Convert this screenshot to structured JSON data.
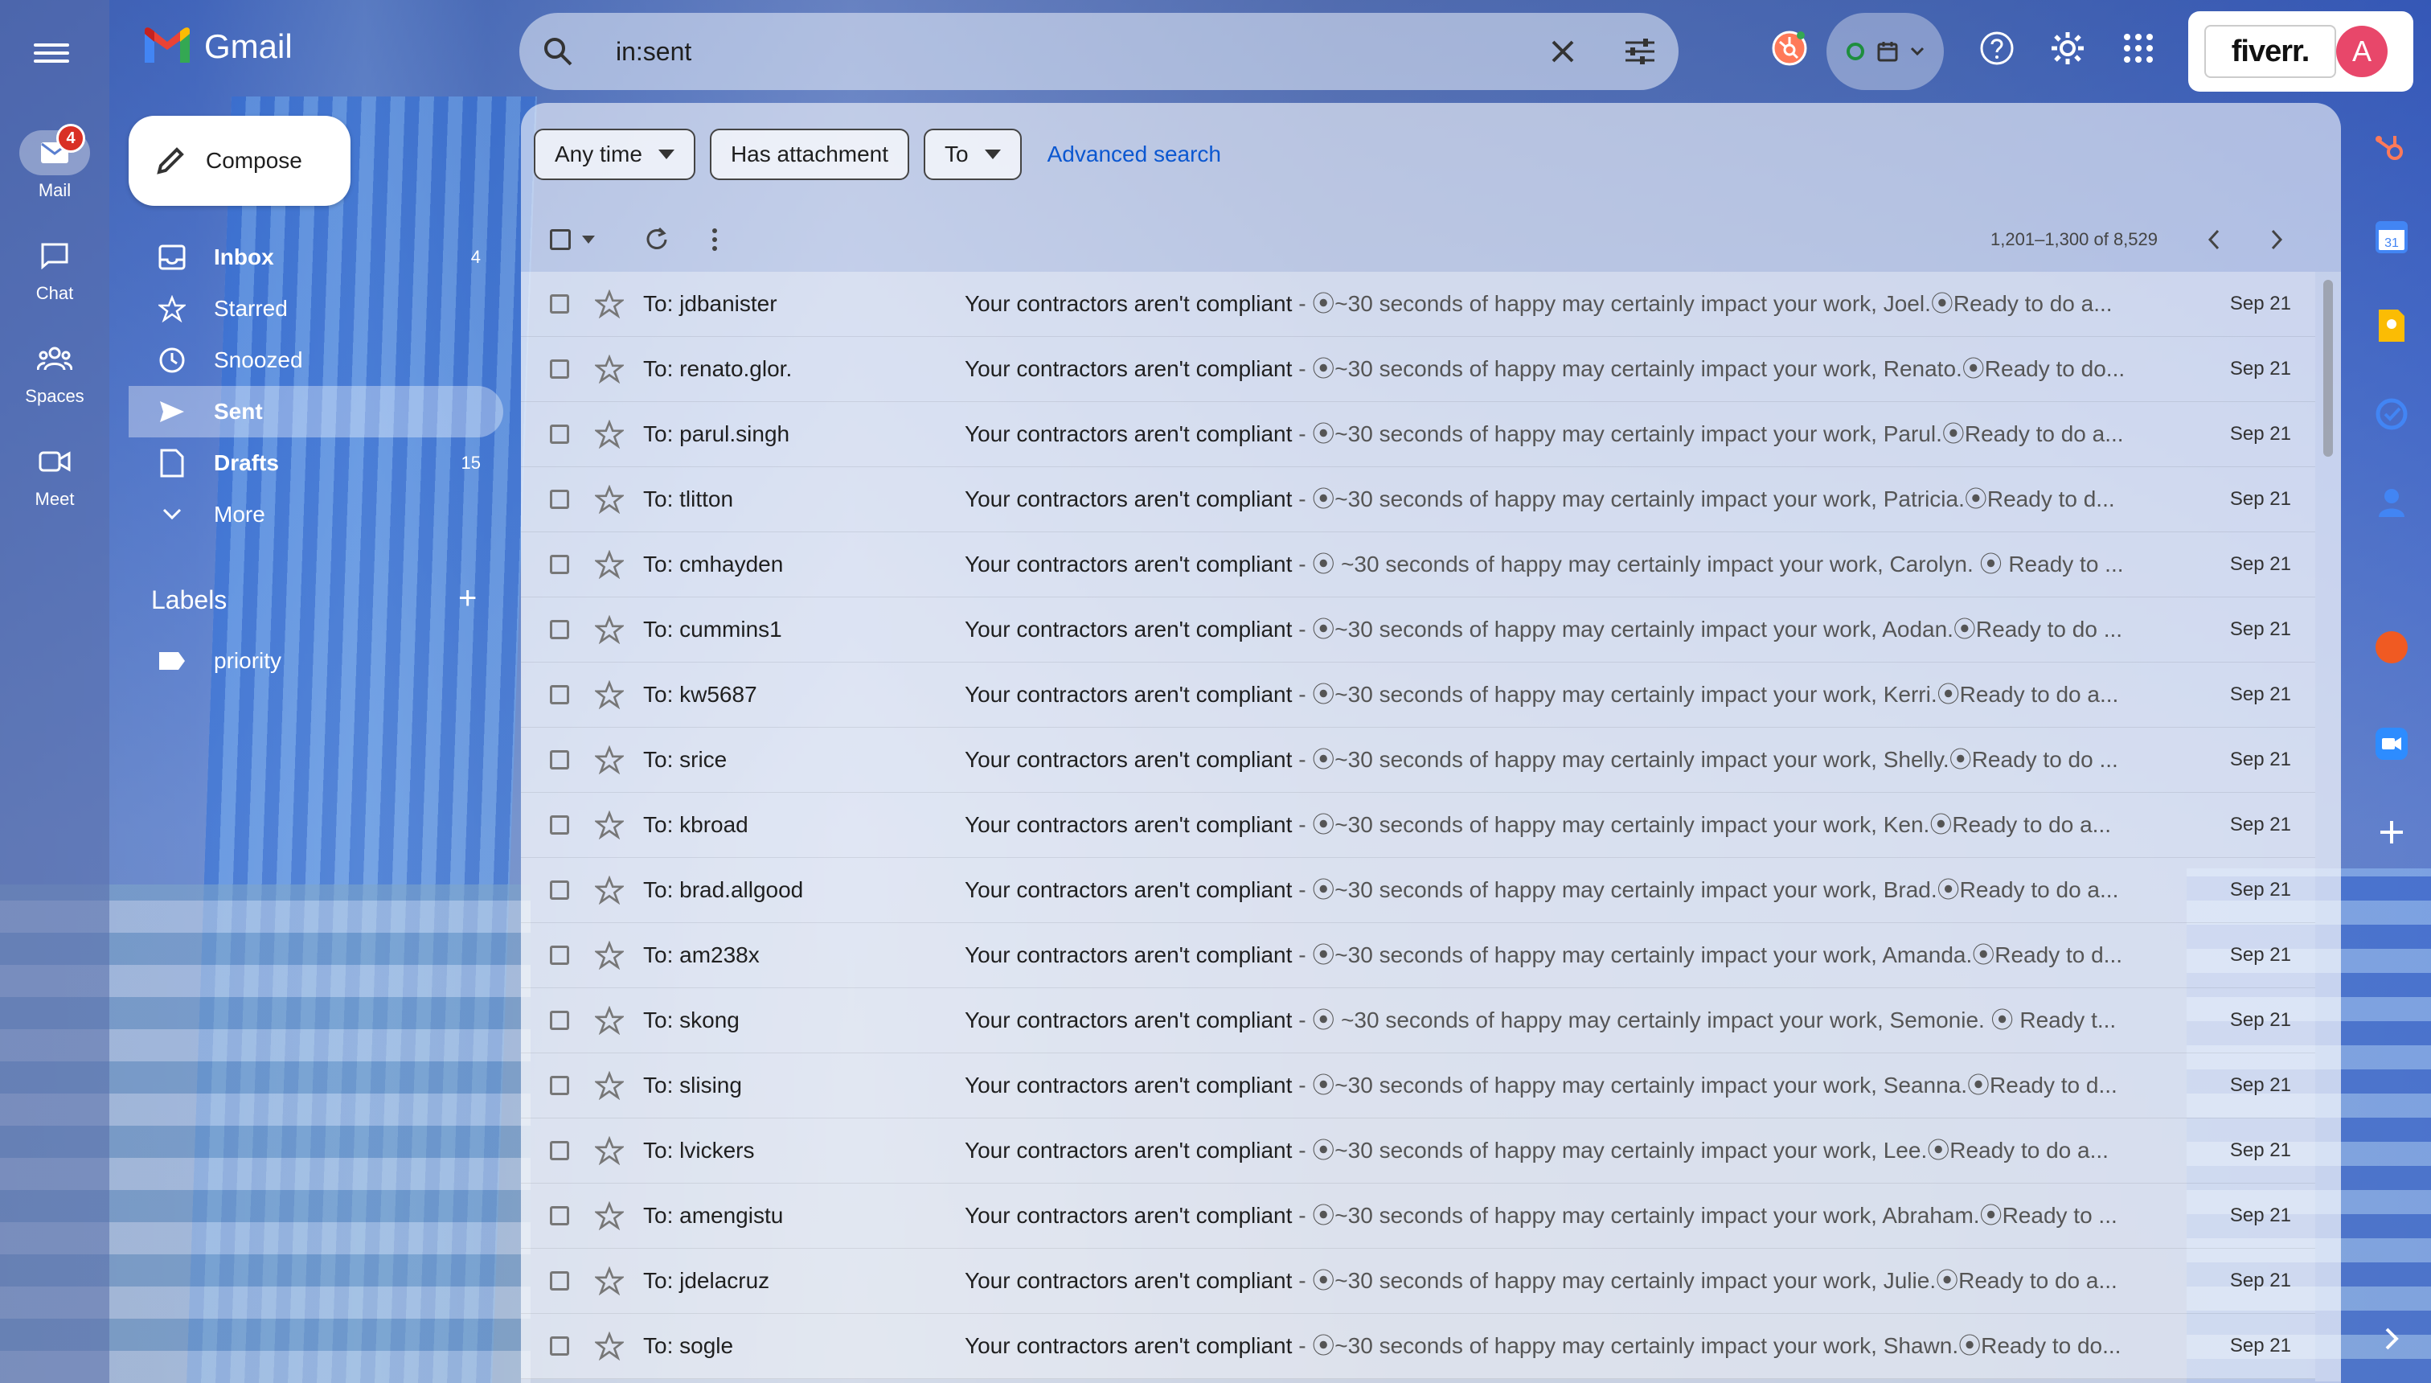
{
  "app": {
    "name": "Gmail"
  },
  "rail": [
    {
      "label": "Mail",
      "badge": "4",
      "icon": "mail-icon"
    },
    {
      "label": "Chat",
      "icon": "chat-icon"
    },
    {
      "label": "Spaces",
      "icon": "spaces-icon"
    },
    {
      "label": "Meet",
      "icon": "meet-icon"
    }
  ],
  "search": {
    "query": "in:sent"
  },
  "profile": {
    "initial": "A",
    "fiverr_label": "fiverr."
  },
  "compose": {
    "label": "Compose"
  },
  "nav": [
    {
      "label": "Inbox",
      "count": "4",
      "icon": "inbox-icon"
    },
    {
      "label": "Starred",
      "count": "",
      "icon": "star-icon"
    },
    {
      "label": "Snoozed",
      "count": "",
      "icon": "clock-icon"
    },
    {
      "label": "Sent",
      "count": "",
      "icon": "send-icon"
    },
    {
      "label": "Drafts",
      "count": "15",
      "icon": "draft-icon"
    },
    {
      "label": "More",
      "count": "",
      "icon": "chevron-down-icon"
    }
  ],
  "labels": {
    "heading": "Labels",
    "items": [
      {
        "label": "priority"
      }
    ]
  },
  "filters": {
    "any_time": "Any time",
    "has_attachment": "Has attachment",
    "to": "To",
    "advanced": "Advanced search"
  },
  "pager": {
    "text": "1,201–1,300 of 8,529"
  },
  "emails": [
    {
      "to": "To: jdbanister",
      "subject": "Your contractors aren't compliant",
      "snippet": " - ⦿~30 seconds of happy may certainly impact your work, Joel.⦿Ready to do a...",
      "date": "Sep 21"
    },
    {
      "to": "To: renato.glor.",
      "subject": "Your contractors aren't compliant",
      "snippet": " - ⦿~30 seconds of happy may certainly impact your work, Renato.⦿Ready to do...",
      "date": "Sep 21"
    },
    {
      "to": "To: parul.singh",
      "subject": "Your contractors aren't compliant",
      "snippet": " - ⦿~30 seconds of happy may certainly impact your work, Parul.⦿Ready to do a...",
      "date": "Sep 21"
    },
    {
      "to": "To: tlitton",
      "subject": "Your contractors aren't compliant",
      "snippet": " - ⦿~30 seconds of happy may certainly impact your work, Patricia.⦿Ready to d...",
      "date": "Sep 21"
    },
    {
      "to": "To: cmhayden",
      "subject": "Your contractors aren't compliant",
      "snippet": " - ⦿ ~30 seconds of happy may certainly impact your work, Carolyn. ⦿ Ready to ...",
      "date": "Sep 21"
    },
    {
      "to": "To: cummins1",
      "subject": "Your contractors aren't compliant",
      "snippet": " - ⦿~30 seconds of happy may certainly impact your work, Aodan.⦿Ready to do ...",
      "date": "Sep 21"
    },
    {
      "to": "To: kw5687",
      "subject": "Your contractors aren't compliant",
      "snippet": " - ⦿~30 seconds of happy may certainly impact your work, Kerri.⦿Ready to do a...",
      "date": "Sep 21"
    },
    {
      "to": "To: srice",
      "subject": "Your contractors aren't compliant",
      "snippet": " - ⦿~30 seconds of happy may certainly impact your work, Shelly.⦿Ready to do ...",
      "date": "Sep 21"
    },
    {
      "to": "To: kbroad",
      "subject": "Your contractors aren't compliant",
      "snippet": " - ⦿~30 seconds of happy may certainly impact your work, Ken.⦿Ready to do a...",
      "date": "Sep 21"
    },
    {
      "to": "To: brad.allgood",
      "subject": "Your contractors aren't compliant",
      "snippet": " - ⦿~30 seconds of happy may certainly impact your work, Brad.⦿Ready to do a...",
      "date": "Sep 21"
    },
    {
      "to": "To: am238x",
      "subject": "Your contractors aren't compliant",
      "snippet": " - ⦿~30 seconds of happy may certainly impact your work, Amanda.⦿Ready to d...",
      "date": "Sep 21"
    },
    {
      "to": "To: skong",
      "subject": "Your contractors aren't compliant",
      "snippet": " - ⦿ ~30 seconds of happy may certainly impact your work, Semonie. ⦿ Ready t...",
      "date": "Sep 21"
    },
    {
      "to": "To: slising",
      "subject": "Your contractors aren't compliant",
      "snippet": " - ⦿~30 seconds of happy may certainly impact your work, Seanna.⦿Ready to d...",
      "date": "Sep 21"
    },
    {
      "to": "To: lvickers",
      "subject": "Your contractors aren't compliant",
      "snippet": " - ⦿~30 seconds of happy may certainly impact your work, Lee.⦿Ready to do a...",
      "date": "Sep 21"
    },
    {
      "to": "To: amengistu",
      "subject": "Your contractors aren't compliant",
      "snippet": " - ⦿~30 seconds of happy may certainly impact your work, Abraham.⦿Ready to ...",
      "date": "Sep 21"
    },
    {
      "to": "To: jdelacruz",
      "subject": "Your contractors aren't compliant",
      "snippet": " - ⦿~30 seconds of happy may certainly impact your work, Julie.⦿Ready to do a...",
      "date": "Sep 21"
    },
    {
      "to": "To: sogle",
      "subject": "Your contractors aren't compliant",
      "snippet": " - ⦿~30 seconds of happy may certainly impact your work, Shawn.⦿Ready to do...",
      "date": "Sep 21"
    }
  ],
  "colors": {
    "accent_blue": "#0b57d0",
    "badge_red": "#d93025",
    "avatar": "#e8476a"
  }
}
